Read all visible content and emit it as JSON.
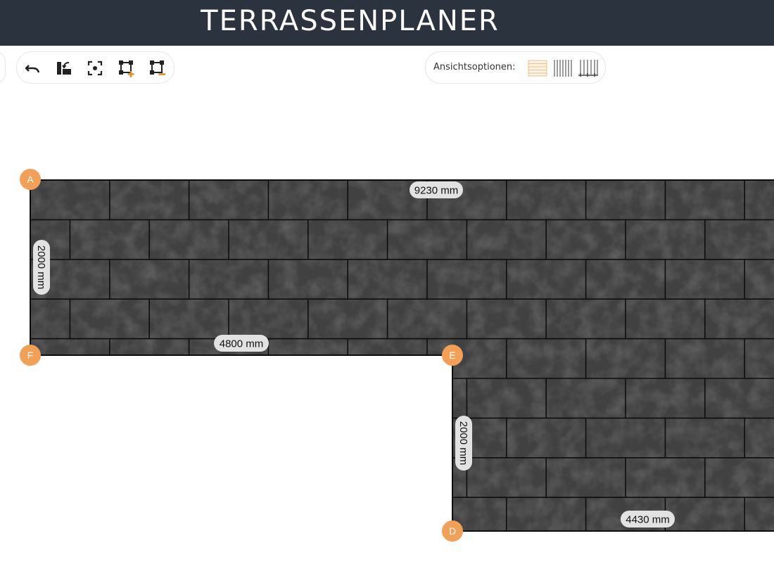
{
  "app": {
    "title": "TERRASSENPLANER"
  },
  "toolbar": {
    "tools": [
      {
        "name": "undo-button",
        "icon": "undo-icon"
      },
      {
        "name": "rotate-button",
        "icon": "rotate-icon"
      },
      {
        "name": "center-view-button",
        "icon": "focus-icon"
      },
      {
        "name": "add-corner-button",
        "icon": "add-vertex-icon"
      },
      {
        "name": "remove-corner-button",
        "icon": "remove-vertex-icon"
      }
    ]
  },
  "view_options": {
    "label": "Ansichtsoptionen:",
    "options": [
      {
        "name": "view-tiles-button",
        "icon": "tiles-icon",
        "active": true
      },
      {
        "name": "view-joists-button",
        "icon": "joists-icon",
        "active": false
      },
      {
        "name": "view-substructure-button",
        "icon": "substructure-icon",
        "active": false
      }
    ]
  },
  "plan": {
    "vertices": [
      "A",
      "F",
      "E",
      "D"
    ],
    "dimensions": {
      "top": "9230 mm",
      "left": "2000 mm",
      "inner_bottom": "4800 mm",
      "inner_right": "2000 mm",
      "bottom": "4430 mm"
    }
  },
  "colors": {
    "header": "#2b333e",
    "vertex_marker": "#f29f57",
    "tile": "#414141",
    "joint": "#0e0e0e",
    "label_bg": "#e2e2e2",
    "accent_orange": "#e68a2e"
  }
}
